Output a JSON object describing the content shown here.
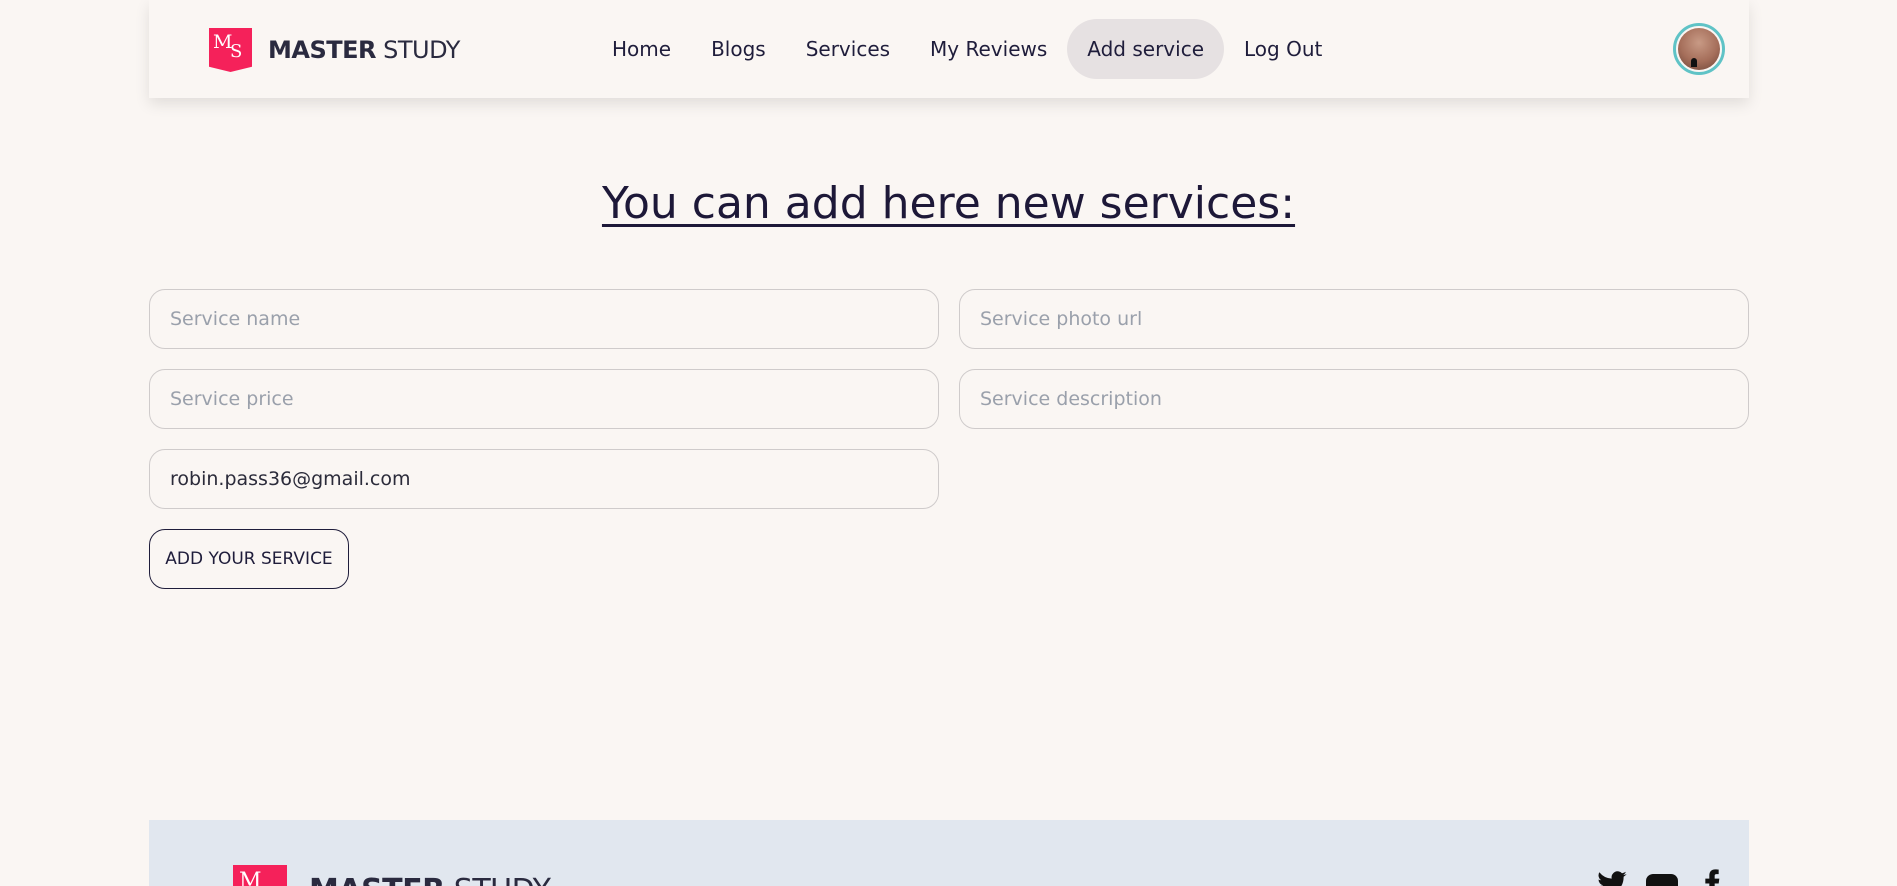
{
  "brand": {
    "badge_m": "M",
    "badge_s": "S",
    "name_bold": "MASTER",
    "name_light": " STUDY"
  },
  "nav": {
    "items": [
      {
        "label": "Home"
      },
      {
        "label": "Blogs"
      },
      {
        "label": "Services"
      },
      {
        "label": "My Reviews"
      },
      {
        "label": "Add service",
        "active": true
      },
      {
        "label": "Log Out"
      }
    ]
  },
  "page": {
    "title": "You can add here new services:"
  },
  "form": {
    "service_name": {
      "placeholder": "Service name",
      "value": ""
    },
    "service_photo": {
      "placeholder": "Service photo url",
      "value": ""
    },
    "service_price": {
      "placeholder": "Service price",
      "value": ""
    },
    "service_description": {
      "placeholder": "Service description",
      "value": ""
    },
    "email": {
      "value": "robin.pass36@gmail.com"
    },
    "submit_label": "ADD YOUR SERVICE"
  },
  "footer": {
    "socials": [
      "twitter-icon",
      "youtube-icon",
      "facebook-icon"
    ]
  },
  "colors": {
    "accent": "#f5215a",
    "background": "#faf6f3",
    "footer": "#e1e7ef",
    "active_nav": "#e6e1e2",
    "avatar_ring": "#5fc3c6",
    "text": "#1f1d3b"
  }
}
